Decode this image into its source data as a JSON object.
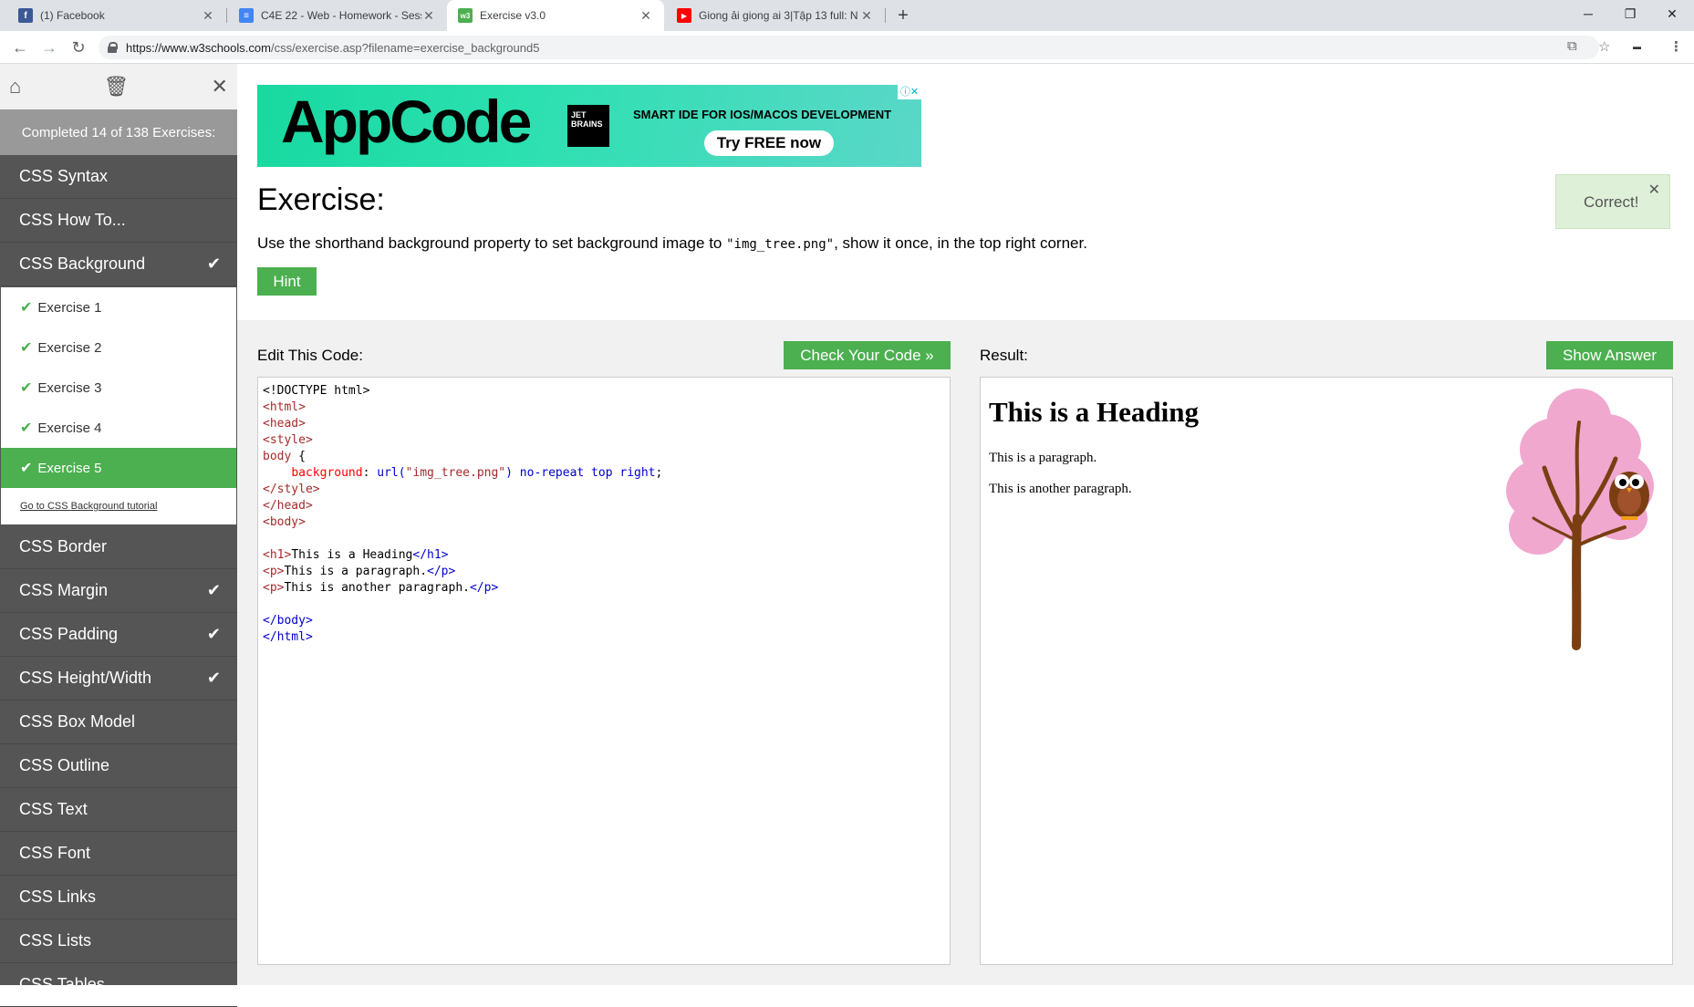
{
  "browser": {
    "tabs": [
      {
        "title": "(1) Facebook",
        "favicon_color": "#3b5998",
        "favicon_text": "f"
      },
      {
        "title": "C4E 22 - Web - Homework - Sess",
        "favicon_color": "#4285f4",
        "favicon_text": "≡"
      },
      {
        "title": "Exercise v3.0",
        "favicon_color": "#4caf50",
        "favicon_text": "w3"
      },
      {
        "title": "Giong ải giong ai 3|Tập 13 full: N",
        "favicon_color": "#ff0000",
        "favicon_text": "▶"
      }
    ],
    "new_tab": "+",
    "url_host": "https://www.w3schools.com",
    "url_path": "/css/exercise.asp?filename=exercise_background5"
  },
  "sidebar": {
    "completed": "Completed 14 of 138 Exercises:",
    "items_before": [
      {
        "label": "CSS Syntax",
        "done": false
      },
      {
        "label": "CSS How To...",
        "done": false
      },
      {
        "label": "CSS Background",
        "done": true
      }
    ],
    "exercises": [
      "Exercise 1",
      "Exercise 2",
      "Exercise 3",
      "Exercise 4",
      "Exercise 5"
    ],
    "tutorial_link": "Go to CSS Background tutorial",
    "items_after": [
      {
        "label": "CSS Border",
        "done": false
      },
      {
        "label": "CSS Margin",
        "done": true
      },
      {
        "label": "CSS Padding",
        "done": true
      },
      {
        "label": "CSS Height/Width",
        "done": true
      },
      {
        "label": "CSS Box Model",
        "done": false
      },
      {
        "label": "CSS Outline",
        "done": false
      },
      {
        "label": "CSS Text",
        "done": false
      },
      {
        "label": "CSS Font",
        "done": false
      },
      {
        "label": "CSS Links",
        "done": false
      },
      {
        "label": "CSS Lists",
        "done": false
      },
      {
        "label": "CSS Tables",
        "done": false
      }
    ]
  },
  "ad": {
    "logo": "AppCode",
    "brand": "JET BRAINS",
    "tagline": "SMART IDE FOR IOS/MACOS DEVELOPMENT",
    "button": "Try FREE now"
  },
  "exercise": {
    "title": "Exercise:",
    "desc_before": "Use the shorthand background property to set background image to ",
    "desc_code": "\"img_tree.png\"",
    "desc_after": ", show it once, in the top right corner.",
    "hint": "Hint",
    "correct": "Correct!"
  },
  "editor": {
    "label": "Edit This Code:",
    "check_button": "Check Your Code »"
  },
  "result": {
    "label": "Result:",
    "answer_button": "Show Answer",
    "heading": "This is a Heading",
    "p1": "This is a paragraph.",
    "p2": "This is another paragraph."
  }
}
